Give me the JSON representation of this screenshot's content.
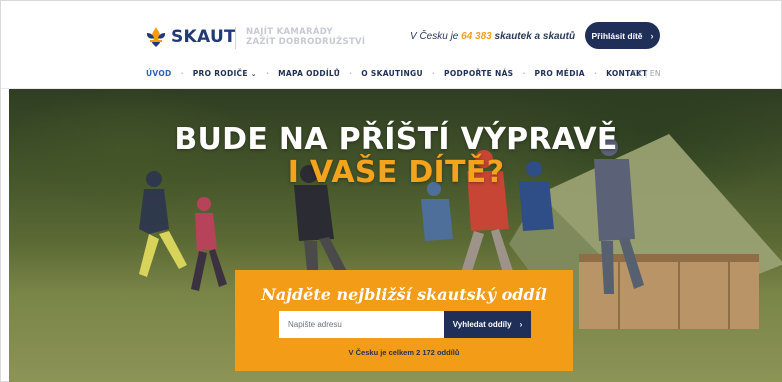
{
  "header": {
    "logo_text": "SKAUT",
    "tagline_line1": "NAJÍT KAMARÁDY",
    "tagline_line2": "ZAŽÍT DOBRODRUŽSTVÍ",
    "stat_prefix": "V Česku je ",
    "stat_number": "64 383",
    "stat_suffix": " skautek a skautů",
    "cta_label": "Přihlásit dítě",
    "cta_icon": "chevron-right-icon"
  },
  "nav": {
    "items": [
      {
        "label": "ÚVOD",
        "active": true
      },
      {
        "label": "PRO RODIČE",
        "has_dropdown": true
      },
      {
        "label": "MAPA ODDÍLŮ"
      },
      {
        "label": "O SKAUTINGU"
      },
      {
        "label": "PODPOŘTE NÁS"
      },
      {
        "label": "PRO MÉDIA"
      },
      {
        "label": "KONTAKT"
      }
    ],
    "lang_cz": "CZ",
    "lang_sep": "|",
    "lang_en": "EN"
  },
  "hero": {
    "title_line1": "BUDE NA PŘÍŠTÍ VÝPRAVĚ",
    "title_line2": "I VAŠE DÍTĚ?"
  },
  "search": {
    "title": "Najděte nejbližší skautský oddíl",
    "placeholder": "Napište adresu",
    "button_label": "Vyhledat oddíly",
    "count_text": "V Česku je celkem 2 172 oddílů"
  },
  "colors": {
    "navy": "#1f2f57",
    "orange": "#f29c18",
    "brand_blue": "#213a79",
    "active_nav": "#2c65b8"
  }
}
